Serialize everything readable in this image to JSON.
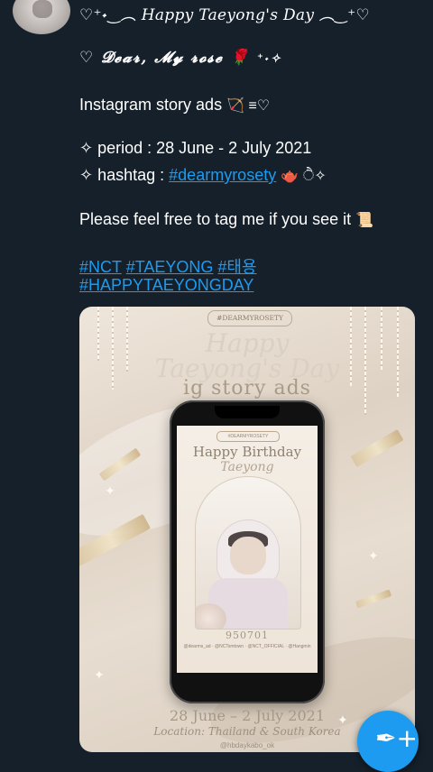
{
  "header": {
    "display_name": "♡⁺˖‿︵ Happy Taeyong's Day ︵‿⁺♡"
  },
  "tweet": {
    "dear_line": "♡ 𝓓𝓮𝓪𝓻, 𝓜𝔂 𝓻𝓸𝓼𝓮",
    "rose": "🌹",
    "dear_suffix": "⁺˖✧",
    "ads_line": "Instagram story ads",
    "ads_emoji": "🏹 ≡♡",
    "period_line": "✧ period : 28 June - 2 July 2021",
    "hashtag_prefix": "✧ hashtag :",
    "hashtag_link": "#dearmyrosety",
    "hashtag_suffix": "🫖 ੈ✧",
    "tag_line": "Please feel free to tag me if you see it",
    "tag_emoji": "📜",
    "tags": [
      "#NCT",
      "#TAEYONG",
      "#태용"
    ],
    "tag_happy": "#HAPPYTAEYONGDAY"
  },
  "media": {
    "tag": "#DEARMYROSETY",
    "title_line1": "Happy",
    "title_line2": "Taeyong's Day",
    "subtitle": "ig story ads",
    "screen": {
      "tag": "#DEARMYROSETY",
      "heading": "Happy Birthday",
      "name": "Taeyong",
      "number": "950701",
      "credits": "@dearms_ad · @NCTsmtown · @NCT_OFFICIAL · @Hangmin"
    },
    "date": "28 June – 2 July 2021",
    "location": "Location: Thailand & South Korea",
    "handle": "@hbdaykabo_ok"
  },
  "compose": {
    "icon": "feather-compose-icon"
  }
}
